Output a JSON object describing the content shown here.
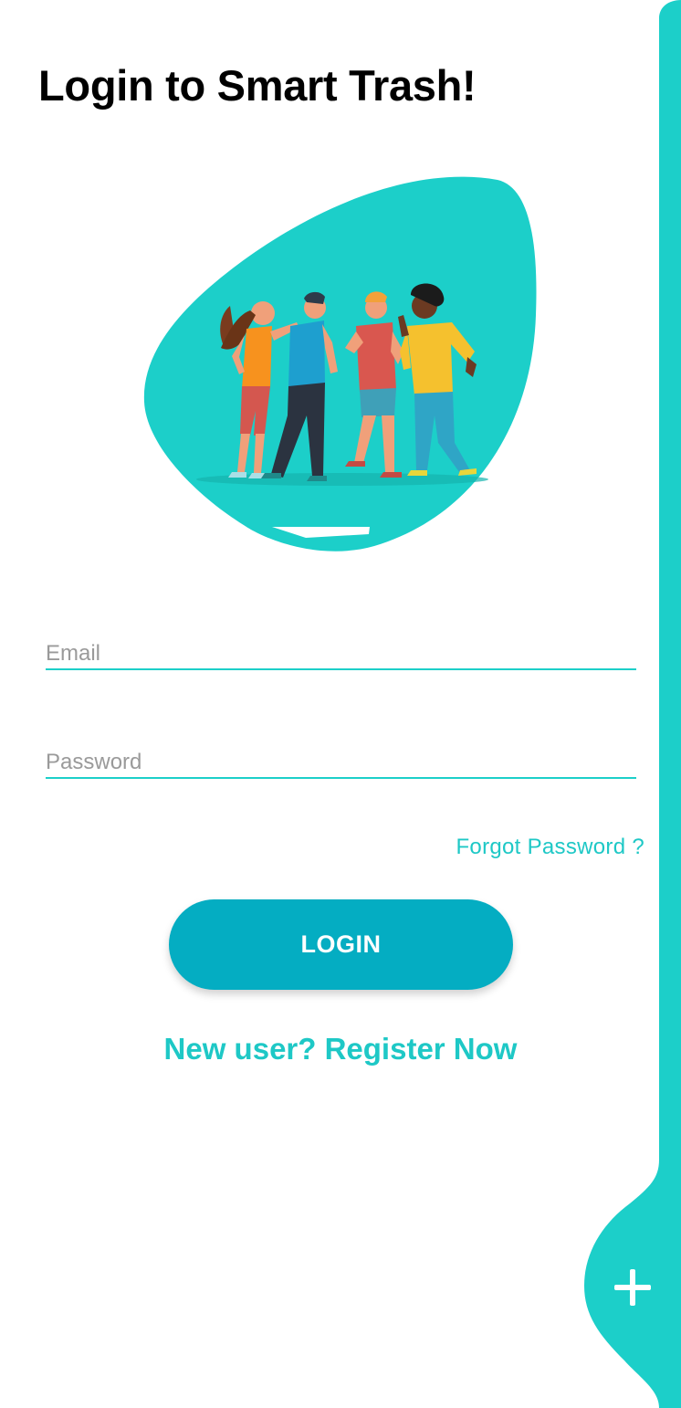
{
  "page": {
    "title": "Login to Smart Trash!"
  },
  "form": {
    "email_placeholder": "Email",
    "password_placeholder": "Password",
    "forgot_password_label": "Forgot Password ?",
    "login_label": "LOGIN",
    "register_label": "New user? Register Now"
  },
  "fab": {
    "icon": "plus-icon"
  },
  "colors": {
    "accent": "#1ccfc9",
    "button": "#04adc2",
    "title": "#000000",
    "placeholder": "#9a9a9a"
  },
  "illustration": {
    "icon": "group-of-people-illustration"
  }
}
